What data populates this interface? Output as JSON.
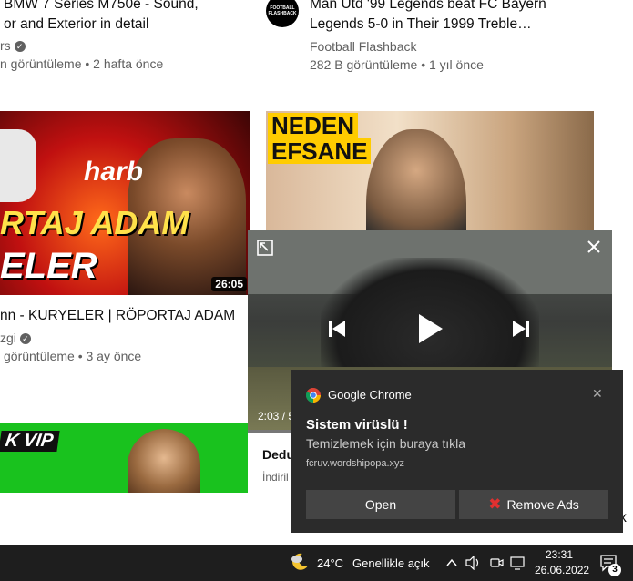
{
  "row1": {
    "left": {
      "title_line1": "BMW 7 Series M750e - Sound,",
      "title_line2": "or and Exterior in detail",
      "channel": "rs",
      "meta": "n görüntüleme • 2 hafta önce"
    },
    "right": {
      "channel_avatar_text": "FOOTBALL FLASHBACK",
      "title_line1": "Man Utd '99 Legends beat FC Bayern",
      "title_line2": "Legends 5-0 in Their 1999 Treble…",
      "channel": "Football Flashback",
      "meta": "282 B görüntüleme • 1 yıl önce"
    }
  },
  "row2": {
    "left": {
      "thumb_text_top": "harb",
      "thumb_text_main": "RTAJ ADAM",
      "thumb_text_sub": "ELER",
      "duration": "26:05",
      "title": "nn - KURYELER | RÖPORTAJ ADAM",
      "channel": "zgi",
      "meta": "görüntüleme • 3 ay önce"
    },
    "right": {
      "thumb_text_1": "NEDEN",
      "thumb_text_2": "EFSANE",
      "title_partial": "Dedu",
      "channel_partial": "İndiril"
    }
  },
  "row3": {
    "left": {
      "thumb_text": "K VIP"
    }
  },
  "miniplayer": {
    "time": "2:03 / 5"
  },
  "toast": {
    "app": "Google Chrome",
    "title": "Sistem virüslü !",
    "message": "Temizlemek için buraya tıkla",
    "source": "fcruv.wordshipopa.xyz",
    "open_label": "Open",
    "remove_label": "Remove Ads",
    "close_glyph": "✕"
  },
  "side_close_glyph": "x",
  "taskbar": {
    "temperature": "24°C",
    "weather": "Genellikle açık",
    "time": "23:31",
    "date": "26.06.2022",
    "notification_count": "3"
  },
  "colors": {
    "toast_bg": "#2b2b2b",
    "taskbar_bg": "#1e1e1e",
    "remove_x": "#e03030",
    "green_thumb": "#19c21e"
  }
}
